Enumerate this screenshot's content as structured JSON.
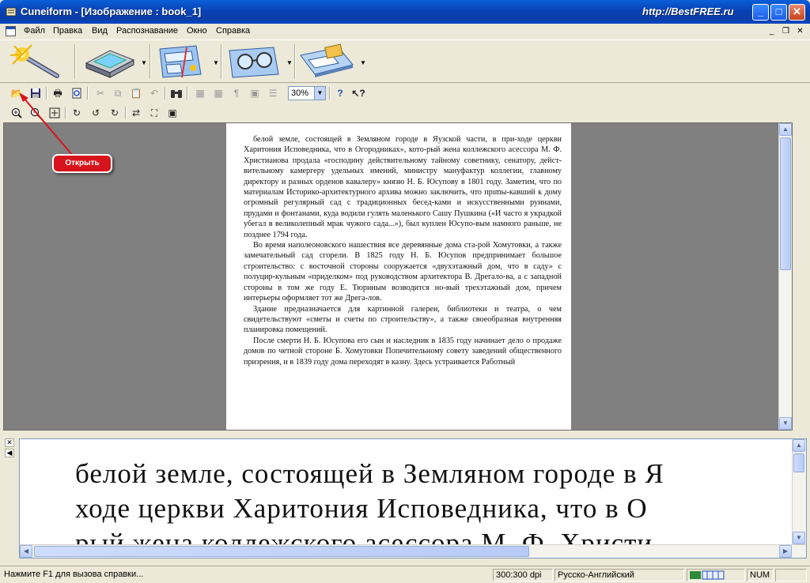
{
  "window": {
    "title": "Cuneiform - [Изображение : book_1]",
    "brand": "http://BestFREE.ru",
    "controls": {
      "minimize": "_",
      "maximize": "□",
      "close": "✕"
    }
  },
  "menu": {
    "items": [
      "Файл",
      "Правка",
      "Вид",
      "Распознавание",
      "Окно",
      "Справка"
    ],
    "mdi": {
      "minimize": "_",
      "restore": "❐",
      "close": "✕"
    }
  },
  "toolbar": {
    "zoom_value": "30%"
  },
  "callout": {
    "label": "Открыть"
  },
  "page_text": {
    "paragraphs": [
      "белой земле, состоящей в Земляном городе в Яузской части, в при-ходе церкви Харитония Исповедника, что в Огородниках», кото-рый жена коллежского асессора М. Ф. Христианова продала «господину действительному тайному советнику, сенатору, дейст-вительному камергеру удельных имений, министру мануфактур коллегии, главному директору и разных орденов кавалеру» князю Н. Б. Юсупову в 1801 году. Заметим, что по материалам Историко-архитектурного архива можно заключить, что прımы-кавший к дому огромный регулярный сад с традиционных бесед-ками и искусственными руинами, прудами и фонтанами, куда водили гулять маленького Сашу Пушкина («И часто я украдкой убегал в великолепный мрак чужого сада...»), был куплен Юсупо-вым намного раньше, не позднее 1794 года.",
      "Во время наполеоновского нашествия все деревянные дома ста-рой Хомутовки, а также замечательный сад сгорели. В 1825 году Н. Б. Юсупов предпринимает большое строительство: с восточной стороны сооружается «двухэтажный дом, что в саду» с полуцир-кульным «приделком» под руководством архитектора В. Дрегало-ва, а с западной стороны в том же году Е. Тюриным возводится но-вый трехэтажный дом, причем интерьеры оформляет тот же Дрега-лов.",
      "Здание предназначается для картинной галереи, библиотеки и театра, о чем свидетельствуют «сметы и счеты по строительству», а также своеобразная внутренняя планировка помещений.",
      "После смерти Н. Б. Юсупова его сын и наследник в 1835 году начинает дело о продаже домов по четной стороне Б. Хомутовки Попечительному совету заведений общественного призрения, и в 1839 году дома переходят в казну. Здесь устраивается Работный"
    ]
  },
  "recognized_text": {
    "lines": [
      "белой земле, состоящей в Земляном городе в Я",
      "ходе церкви Харитония Исповедника, что в О",
      "рый жена коллежского асессора М. Ф. Христи"
    ]
  },
  "statusbar": {
    "hint": "Нажмите F1 для вызова справки...",
    "dpi": "300:300 dpi",
    "language": "Русско-Английский",
    "num": "NUM"
  }
}
